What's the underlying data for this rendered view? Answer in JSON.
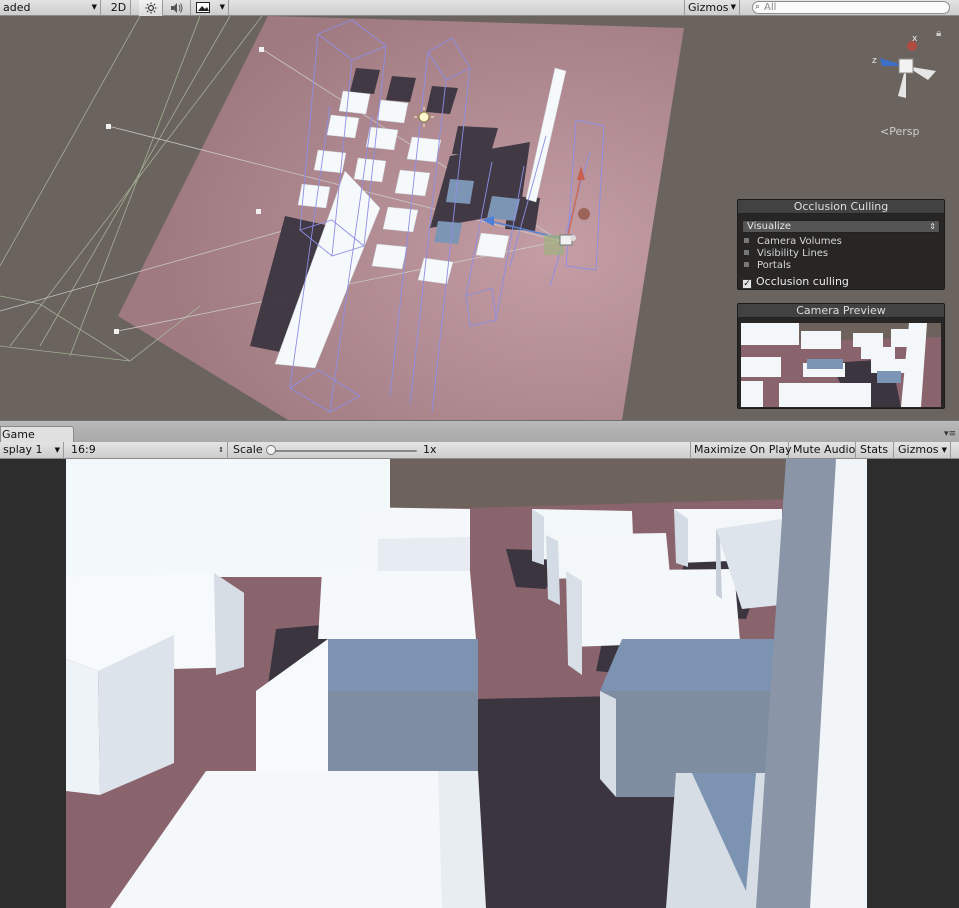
{
  "scene_toolbar": {
    "shading_mode": "aded",
    "mode_2d": "2D",
    "lighting_icon": "sun-icon",
    "audio_icon": "speaker-icon",
    "effects_icon": "image-icon",
    "gizmos_label": "Gizmos",
    "search_placeholder": "All"
  },
  "scene_view": {
    "projection_label": "Persp",
    "axis_labels": {
      "x": "x",
      "z": "z"
    },
    "occlusion_panel": {
      "title": "Occlusion Culling",
      "mode": "Visualize",
      "options": [
        "Camera Volumes",
        "Visibility Lines",
        "Portals"
      ],
      "checkbox_label": "Occlusion culling",
      "checked": true
    },
    "camera_preview": {
      "title": "Camera Preview"
    }
  },
  "game_tab": {
    "label": "Game"
  },
  "game_toolbar": {
    "display": "splay 1",
    "aspect": "16:9",
    "scale_label": "Scale",
    "scale_value": "1x",
    "maximize_on_play": "Maximize On Play",
    "mute_audio": "Mute Audio",
    "stats": "Stats",
    "gizmos": "Gizmos"
  },
  "colors": {
    "toolbar_bg": "#d6d6d6",
    "scene_ground": "#6b645e",
    "scene_plane": "#a98289",
    "box_white": "#f4f8fb",
    "box_selected": "#7d95b4",
    "wireframe": "#8e8ee6",
    "game_sky": "#6e625c",
    "game_ground": "#8a646c",
    "shadow": "#3b3540"
  }
}
